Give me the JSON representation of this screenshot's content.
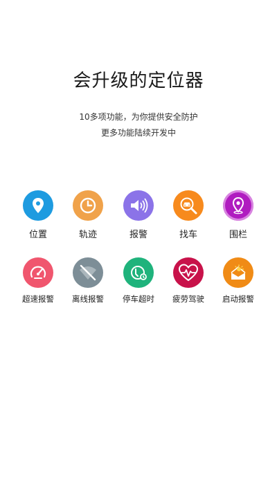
{
  "title": "会升级的定位器",
  "subtitle_line1": "10多项功能，为你提供安全防护",
  "subtitle_line2": "更多功能陆续开发中",
  "row1": [
    {
      "label": "位置",
      "icon": "location-pin-icon",
      "color": "#1e9be0"
    },
    {
      "label": "轨迹",
      "icon": "clock-icon",
      "color": "#f0a24a"
    },
    {
      "label": "报警",
      "icon": "speaker-icon",
      "color": "#8b73e8"
    },
    {
      "label": "找车",
      "icon": "car-search-icon",
      "color": "#f78a1d"
    },
    {
      "label": "围栏",
      "icon": "fence-pin-icon",
      "color": "#b01cc0"
    }
  ],
  "row2": [
    {
      "label": "超速报警",
      "icon": "speedometer-icon",
      "color": "#f0566e"
    },
    {
      "label": "离线报警",
      "icon": "wifi-off-icon",
      "color": "#7d8e97"
    },
    {
      "label": "停车超时",
      "icon": "parking-timer-icon",
      "color": "#1fb37c"
    },
    {
      "label": "疲劳驾驶",
      "icon": "heartbeat-icon",
      "color": "#c8124a"
    },
    {
      "label": "启动报警",
      "icon": "ignition-icon",
      "color": "#f08b16"
    }
  ]
}
